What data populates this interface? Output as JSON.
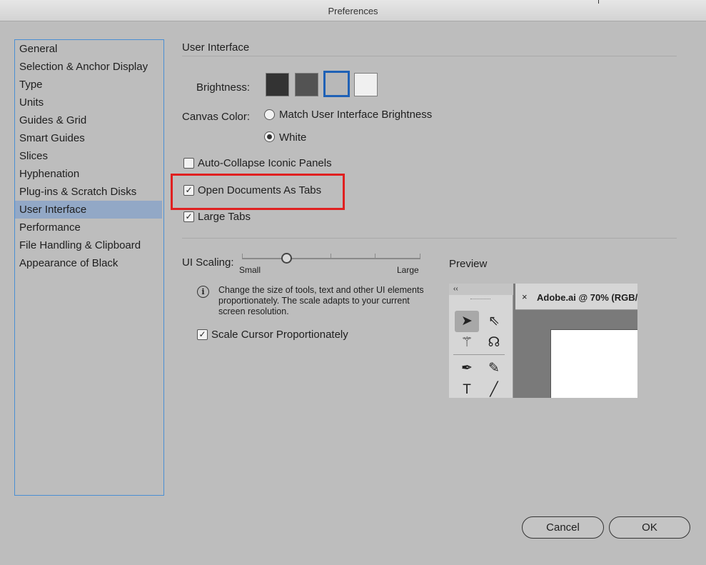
{
  "window": {
    "title": "Preferences"
  },
  "sidebar": {
    "items": [
      {
        "label": "General"
      },
      {
        "label": "Selection & Anchor Display"
      },
      {
        "label": "Type"
      },
      {
        "label": "Units"
      },
      {
        "label": "Guides & Grid"
      },
      {
        "label": "Smart Guides"
      },
      {
        "label": "Slices"
      },
      {
        "label": "Hyphenation"
      },
      {
        "label": "Plug-ins & Scratch Disks"
      },
      {
        "label": "User Interface"
      },
      {
        "label": "Performance"
      },
      {
        "label": "File Handling & Clipboard"
      },
      {
        "label": "Appearance of Black"
      }
    ],
    "selected": "User Interface"
  },
  "panel": {
    "section_title": "User Interface",
    "brightness": {
      "label": "Brightness:",
      "swatches": [
        "#333333",
        "#535353",
        "#b8b8b8",
        "#f0f0f0"
      ],
      "selected_index": 2
    },
    "canvas_color": {
      "label": "Canvas Color:",
      "options": [
        "Match User Interface Brightness",
        "White"
      ],
      "selected": "White"
    },
    "checkboxes": {
      "auto_collapse": {
        "label": "Auto-Collapse Iconic Panels",
        "checked": false
      },
      "open_as_tabs": {
        "label": "Open Documents As Tabs",
        "checked": true
      },
      "large_tabs": {
        "label": "Large Tabs",
        "checked": true
      }
    },
    "ui_scaling": {
      "label": "UI Scaling:",
      "min_label": "Small",
      "max_label": "Large",
      "info_text": "Change the size of tools, text and other UI elements proportionately. The scale adapts to your current screen resolution.",
      "scale_cursor": {
        "label": "Scale Cursor Proportionately",
        "checked": true
      }
    },
    "preview": {
      "label": "Preview",
      "collapse_glyph": "‹‹",
      "tab_close": "×",
      "doc_tab": "Adobe.ai @ 70% (RGB/"
    }
  },
  "buttons": {
    "cancel": "Cancel",
    "ok": "OK"
  },
  "colors": {
    "accent": "#1f61b6",
    "highlight": "#e02020",
    "selection": "#92a8c6"
  }
}
